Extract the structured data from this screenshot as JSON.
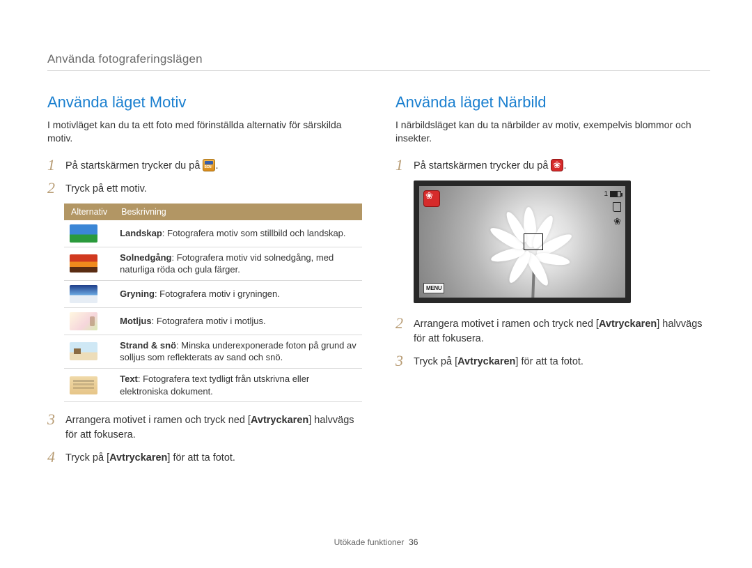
{
  "page_header": "Använda fotograferingslägen",
  "footer": {
    "section": "Utökade funktioner",
    "page": "36"
  },
  "left": {
    "title": "Använda läget Motiv",
    "intro": "I motivläget kan du ta ett foto med förinställda alternativ för särskilda motiv.",
    "step1_pre": "På startskärmen trycker du på ",
    "step1_post": ".",
    "step2": "Tryck på ett motiv.",
    "table": {
      "col1": "Alternativ",
      "col2": "Beskrivning",
      "rows": [
        {
          "name": "Landskap",
          "desc": ": Fotografera motiv som stillbild och landskap."
        },
        {
          "name": "Solnedgång",
          "desc": ": Fotografera motiv vid solnedgång, med naturliga röda och gula färger."
        },
        {
          "name": "Gryning",
          "desc": ": Fotografera motiv i gryningen."
        },
        {
          "name": "Motljus",
          "desc": ": Fotografera motiv i motljus."
        },
        {
          "name": "Strand & snö",
          "desc": ": Minska underexponerade foton på grund av solljus som reflekterats av sand och snö."
        },
        {
          "name": "Text",
          "desc": ": Fotografera text tydligt från utskrivna eller elektroniska dokument."
        }
      ]
    },
    "step3_pre": "Arrangera motivet i ramen och tryck ned [",
    "step3_bold": "Avtryckaren",
    "step3_post": "] halvvägs för att fokusera.",
    "step4_pre": "Tryck på [",
    "step4_bold": "Avtryckaren",
    "step4_post": "] för att ta fotot."
  },
  "right": {
    "title": "Använda läget Närbild",
    "intro": "I närbildsläget kan du ta närbilder av motiv, exempelvis blommor och insekter.",
    "step1_pre": "På startskärmen trycker du på ",
    "step1_post": ".",
    "screen": {
      "shots": "1",
      "menu": "MENU"
    },
    "step2_pre": "Arrangera motivet i ramen och tryck ned [",
    "step2_bold": "Avtryckaren",
    "step2_post": "] halvvägs för att fokusera.",
    "step3_pre": "Tryck på [",
    "step3_bold": "Avtryckaren",
    "step3_post": "] för att ta fotot."
  },
  "nums": {
    "n1": "1",
    "n2": "2",
    "n3": "3",
    "n4": "4"
  }
}
